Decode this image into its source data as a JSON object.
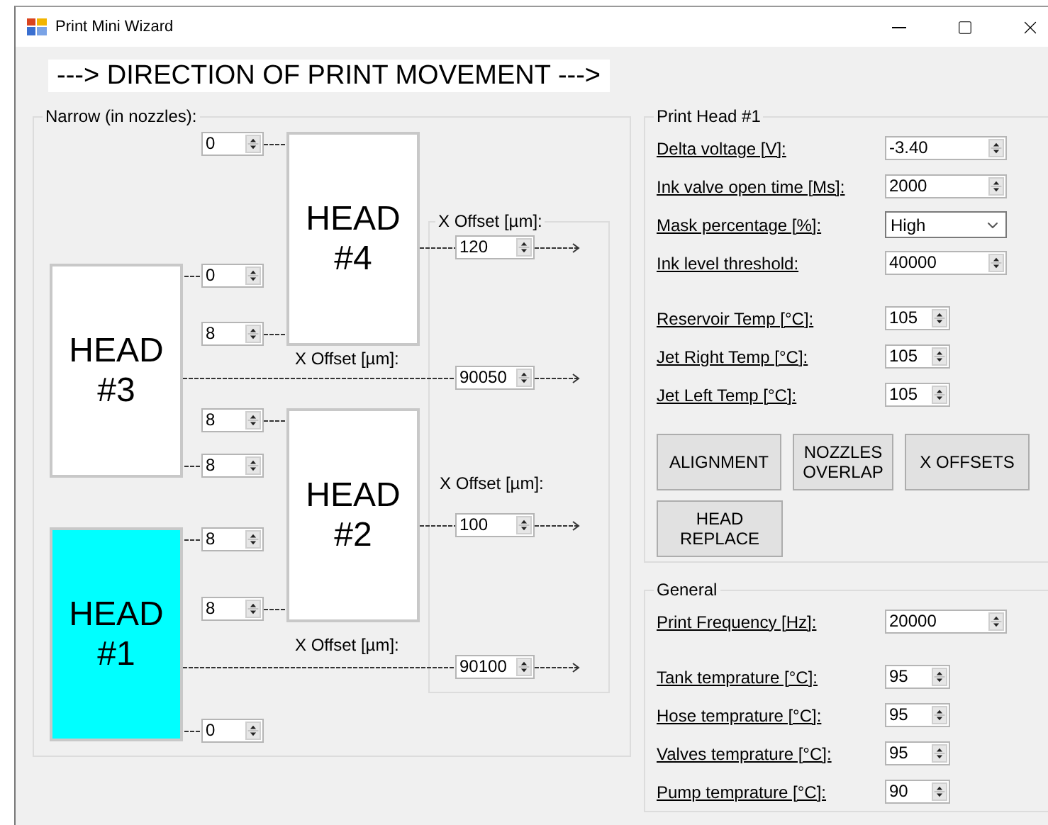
{
  "window": {
    "title": "Print Mini Wizard"
  },
  "direction_label": "---> DIRECTION OF PRINT MOVEMENT --->",
  "narrow_panel": {
    "title": "Narrow (in nozzles):",
    "heads": [
      {
        "label": "HEAD #4",
        "selected": false
      },
      {
        "label": "HEAD #3",
        "selected": false
      },
      {
        "label": "HEAD #2",
        "selected": false
      },
      {
        "label": "HEAD #1",
        "selected": true
      }
    ],
    "narrow_values": [
      "0",
      "0",
      "8",
      "8",
      "8",
      "8",
      "8",
      "0"
    ],
    "x_offset_panel": {
      "title": "X Offset [µm]:",
      "offsets": [
        {
          "value": "120"
        },
        {
          "label": "X Offset [µm]:",
          "value": "90050"
        },
        {
          "label": "X Offset [µm]:",
          "value": "100"
        },
        {
          "label": "X Offset [µm]:",
          "value": "90100"
        }
      ]
    }
  },
  "print_head": {
    "title": "Print Head #1",
    "field_groups": [
      [
        {
          "label": "Delta voltage [V]:",
          "value": "-3.40",
          "kind": "spinner"
        },
        {
          "label": "Ink valve open time [Ms]:",
          "value": "2000",
          "kind": "spinner"
        },
        {
          "label": "Mask percentage [%]:",
          "value": "High",
          "kind": "dropdown"
        },
        {
          "label": "Ink level threshold:",
          "value": "40000",
          "kind": "spinner"
        }
      ],
      [
        {
          "label": "Reservoir Temp [°C]:",
          "value": "105",
          "kind": "small_spinner"
        },
        {
          "label": "Jet Right Temp [°C]:",
          "value": "105",
          "kind": "small_spinner"
        },
        {
          "label": "Jet Left Temp [°C]:",
          "value": "105",
          "kind": "small_spinner"
        }
      ]
    ],
    "buttons": [
      "ALIGNMENT",
      "NOZZLES OVERLAP",
      "X OFFSETS",
      "HEAD REPLACE"
    ]
  },
  "general": {
    "title": "General",
    "field_groups": [
      [
        {
          "label": "Print Frequency [Hz]:",
          "value": "20000",
          "kind": "spinner"
        }
      ],
      [
        {
          "label": "Tank temprature [°C]:",
          "value": "95",
          "kind": "small_spinner"
        },
        {
          "label": "Hose temprature [°C]:",
          "value": "95",
          "kind": "small_spinner"
        },
        {
          "label": "Valves temprature [°C]:",
          "value": "95",
          "kind": "small_spinner"
        },
        {
          "label": "Pump temprature [°C]:",
          "value": "90",
          "kind": "small_spinner"
        }
      ]
    ]
  }
}
